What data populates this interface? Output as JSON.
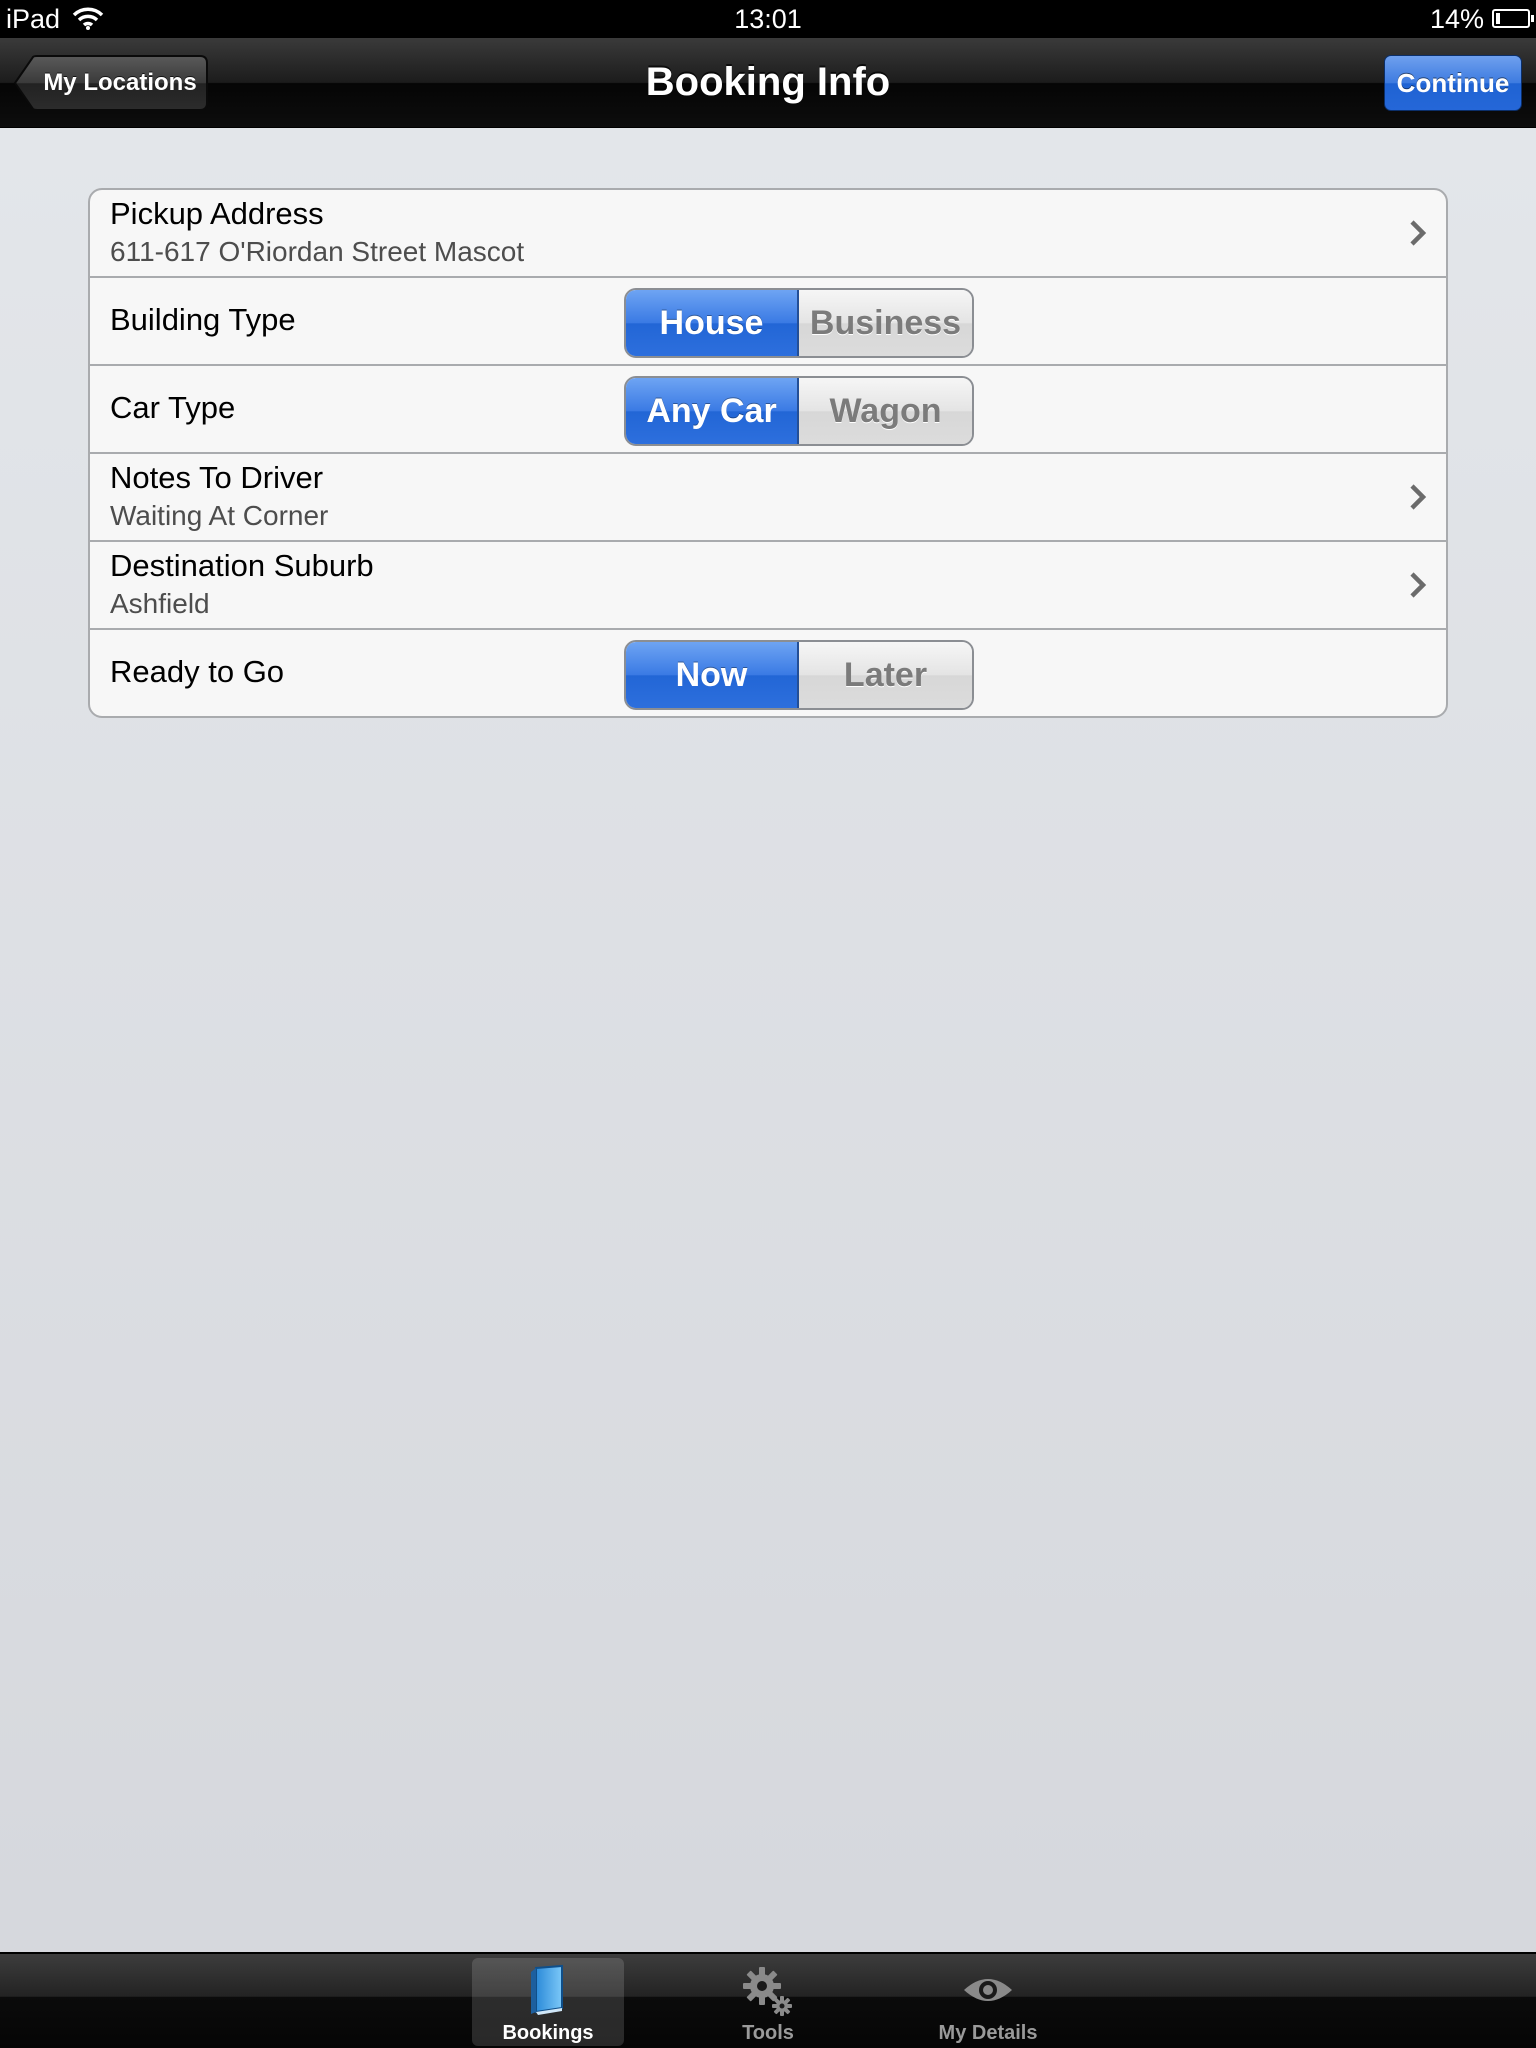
{
  "status_bar": {
    "carrier": "iPad",
    "time": "13:01",
    "battery": "14%"
  },
  "nav": {
    "back_label": "My Locations",
    "title": "Booking Info",
    "action_label": "Continue"
  },
  "rows": {
    "pickup": {
      "title": "Pickup Address",
      "value": "611-617 O'Riordan Street Mascot"
    },
    "building_type": {
      "title": "Building Type",
      "options": [
        "House",
        "Business"
      ],
      "selected": "House"
    },
    "car_type": {
      "title": "Car Type",
      "options": [
        "Any Car",
        "Wagon"
      ],
      "selected": "Any Car"
    },
    "notes": {
      "title": "Notes To Driver",
      "value": "Waiting At Corner"
    },
    "destination": {
      "title": "Destination Suburb",
      "value": "Ashfield"
    },
    "ready": {
      "title": "Ready to Go",
      "options": [
        "Now",
        "Later"
      ],
      "selected": "Now"
    }
  },
  "tabs": [
    {
      "label": "Bookings",
      "icon": "book-icon",
      "active": true
    },
    {
      "label": "Tools",
      "icon": "gears-icon",
      "active": false
    },
    {
      "label": "My Details",
      "icon": "eye-icon",
      "active": false
    }
  ],
  "colors": {
    "accent_blue": "#2d6fdd",
    "background": "#dfe1e5",
    "bar_dark": "#1c1c1c"
  }
}
